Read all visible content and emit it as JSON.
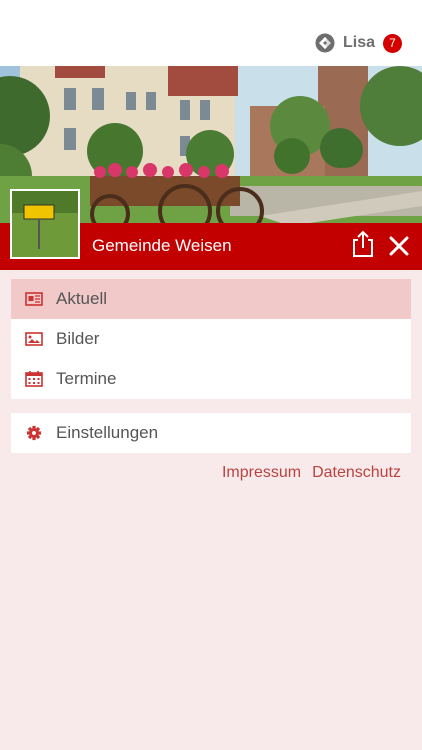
{
  "header": {
    "user_name": "Lisa",
    "notification_count": "7",
    "brand_color": "#c30000"
  },
  "community": {
    "title": "Gemeinde Weisen"
  },
  "menu": {
    "items": [
      {
        "label": "Aktuell",
        "icon": "newspaper-icon",
        "active": true
      },
      {
        "label": "Bilder",
        "icon": "image-icon",
        "active": false
      },
      {
        "label": "Termine",
        "icon": "calendar-icon",
        "active": false
      }
    ],
    "settings": {
      "label": "Einstellungen",
      "icon": "gear-icon"
    }
  },
  "footer_links": {
    "impressum": "Impressum",
    "datenschutz": "Datenschutz"
  }
}
